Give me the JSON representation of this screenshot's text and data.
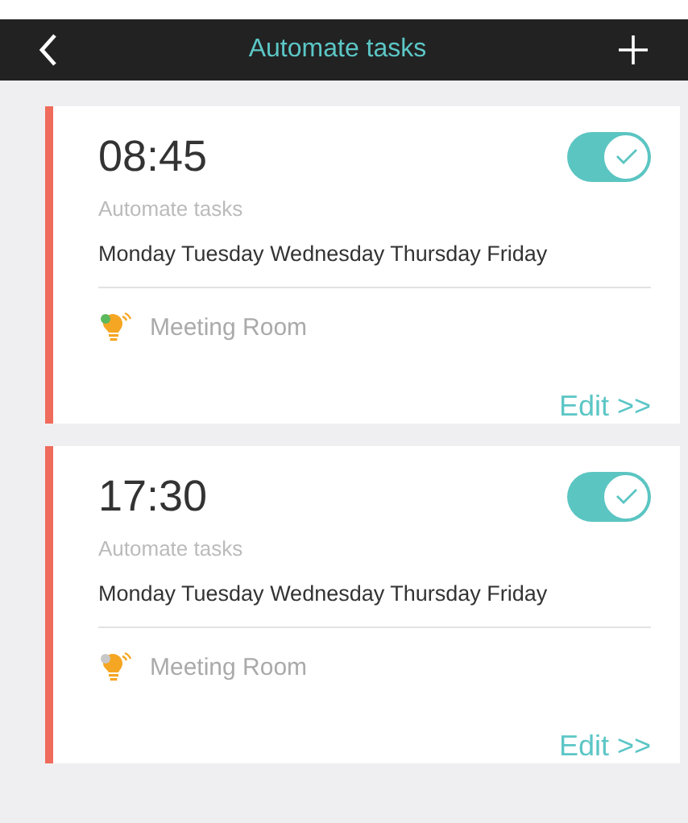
{
  "header": {
    "title": "Automate tasks"
  },
  "tasks": [
    {
      "time": "08:45",
      "label": "Automate tasks",
      "days": "Monday Tuesday Wednesday Thursday Friday",
      "on": true,
      "device": {
        "name": "Meeting Room",
        "color": "#5cb85c"
      },
      "action": "Edit >>"
    },
    {
      "time": "17:30",
      "label": "Automate tasks",
      "days": "Monday Tuesday Wednesday Thursday Friday",
      "on": true,
      "device": {
        "name": "Meeting Room",
        "color": "#c8c8c8"
      },
      "action": "Edit >>"
    }
  ]
}
